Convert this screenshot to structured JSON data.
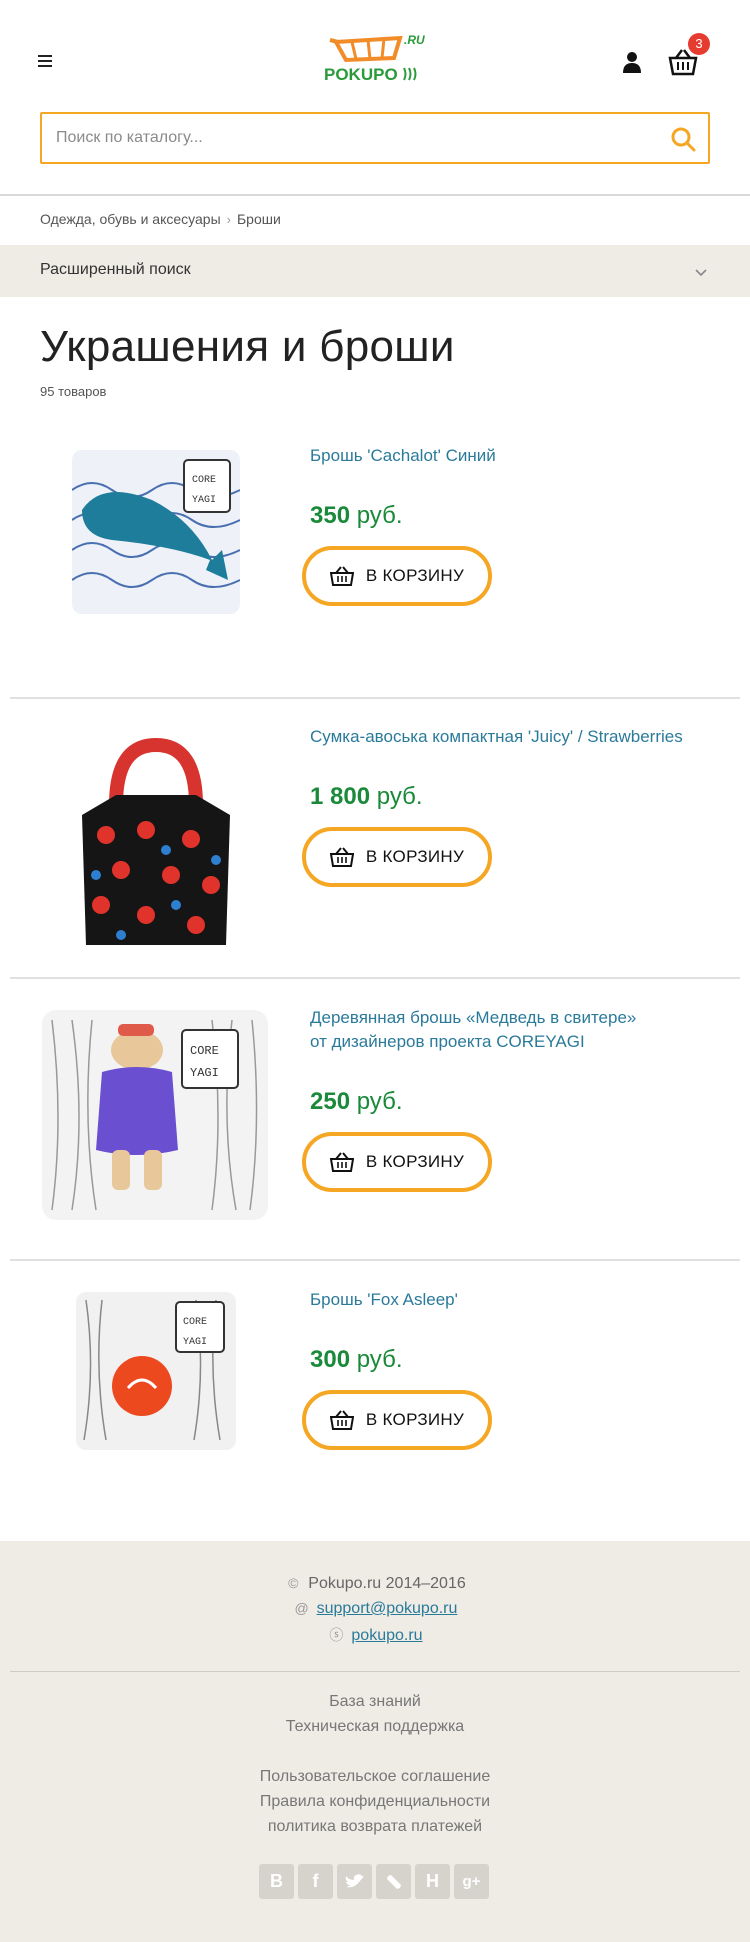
{
  "header": {
    "logo_text": "POKUPO",
    "logo_domain": ".RU",
    "cart_count": "3"
  },
  "search": {
    "placeholder": "Поиск по каталогу..."
  },
  "breadcrumb": {
    "items": [
      "Одежда, обувь и аксесуары",
      "Броши"
    ]
  },
  "advanced_search": {
    "label": "Расширенный поиск"
  },
  "page": {
    "title": "Украшения и броши",
    "count": "95 товаров"
  },
  "products": [
    {
      "name": "Брошь 'Cachalot' Синий",
      "price_value": "350",
      "price_currency": "руб.",
      "button": "В КОРЗИНУ",
      "image": "whale-brooch"
    },
    {
      "name": "Сумка-авоська компактная 'Juicy' / Strawberries",
      "price_value": "1 800",
      "price_currency": "руб.",
      "button": "В КОРЗИНУ",
      "image": "strawberry-bag"
    },
    {
      "name_line1": "Деревянная брошь «Медведь в свитере»",
      "name_line2": "от дизайнеров проекта COREYAGI",
      "price_value": "250",
      "price_currency": "руб.",
      "button": "В КОРЗИНУ",
      "image": "bear-brooch"
    },
    {
      "name": "Брошь 'Fox Asleep'",
      "price_value": "300",
      "price_currency": "руб.",
      "button": "В КОРЗИНУ",
      "image": "fox-brooch"
    }
  ],
  "footer": {
    "copyright": "Pokupo.ru 2014–2016",
    "email": "support@pokupo.ru",
    "skype": "pokupo.ru",
    "links1": [
      "База знаний",
      "Техническая поддержка"
    ],
    "links2": [
      "Пользовательское соглашение",
      "Правила конфиденциальности",
      "политика возврата платежей"
    ],
    "socials": [
      "vk-icon",
      "facebook-icon",
      "twitter-icon",
      "livejournal-icon",
      "habr-icon",
      "googleplus-icon"
    ]
  },
  "colors": {
    "accent": "#f5a623",
    "price": "#1a8a3a",
    "link": "#2a7a9a",
    "badge": "#e63c2f"
  }
}
